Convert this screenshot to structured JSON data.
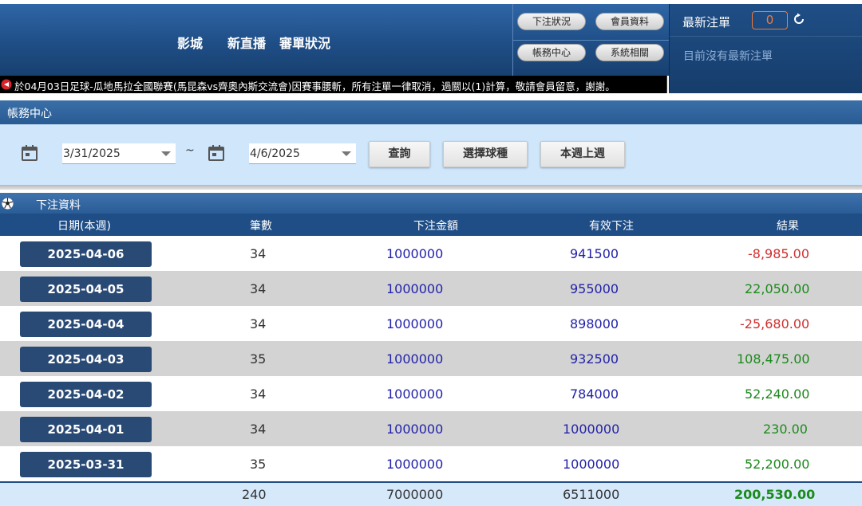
{
  "header": {
    "nav": [
      "影城",
      "新直播",
      "審單狀況"
    ],
    "buttons": [
      "下注狀況",
      "會員資料",
      "帳務中心",
      "系統相關"
    ]
  },
  "latest": {
    "title": "最新注單",
    "count": "0",
    "message": "目前沒有最新注單"
  },
  "ticker": {
    "text": "於04月03日足球-瓜地馬拉全國聯賽(馬昆森vs齊奧內斯交流會)因賽事腰斬，所有注單一律取消，過關以(1)計算，敬請會員留意，謝謝。"
  },
  "section": {
    "title": "帳務中心"
  },
  "filter": {
    "start_date": "3/31/2025",
    "separator": "~",
    "end_date": "4/6/2025",
    "query_label": "查詢",
    "sport_label": "選擇球種",
    "week_label": "本週上週"
  },
  "table": {
    "title": "下注資料",
    "columns": [
      "日期(本週)",
      "筆數",
      "下注金額",
      "有效下注",
      "結果"
    ],
    "rows": [
      {
        "date": "2025-04-06",
        "count": "34",
        "bet": "1000000",
        "valid": "941500",
        "result": "-8,985.00"
      },
      {
        "date": "2025-04-05",
        "count": "34",
        "bet": "1000000",
        "valid": "955000",
        "result": "22,050.00"
      },
      {
        "date": "2025-04-04",
        "count": "34",
        "bet": "1000000",
        "valid": "898000",
        "result": "-25,680.00"
      },
      {
        "date": "2025-04-03",
        "count": "35",
        "bet": "1000000",
        "valid": "932500",
        "result": "108,475.00"
      },
      {
        "date": "2025-04-02",
        "count": "34",
        "bet": "1000000",
        "valid": "784000",
        "result": "52,240.00"
      },
      {
        "date": "2025-04-01",
        "count": "34",
        "bet": "1000000",
        "valid": "1000000",
        "result": "230.00"
      },
      {
        "date": "2025-03-31",
        "count": "35",
        "bet": "1000000",
        "valid": "1000000",
        "result": "52,200.00"
      }
    ],
    "total": {
      "count": "240",
      "bet": "7000000",
      "valid": "6511000",
      "result": "200,530.00"
    }
  },
  "colors": {
    "header_blue": "#1f4e86",
    "positive": "#1c8a1c",
    "negative": "#d03030",
    "amount_blue": "#2222aa",
    "count_badge": "#f07a3a"
  },
  "icons": [
    "calendar-icon",
    "refresh-icon",
    "soccer-ball-icon",
    "alert-icon",
    "caret-down-icon"
  ]
}
